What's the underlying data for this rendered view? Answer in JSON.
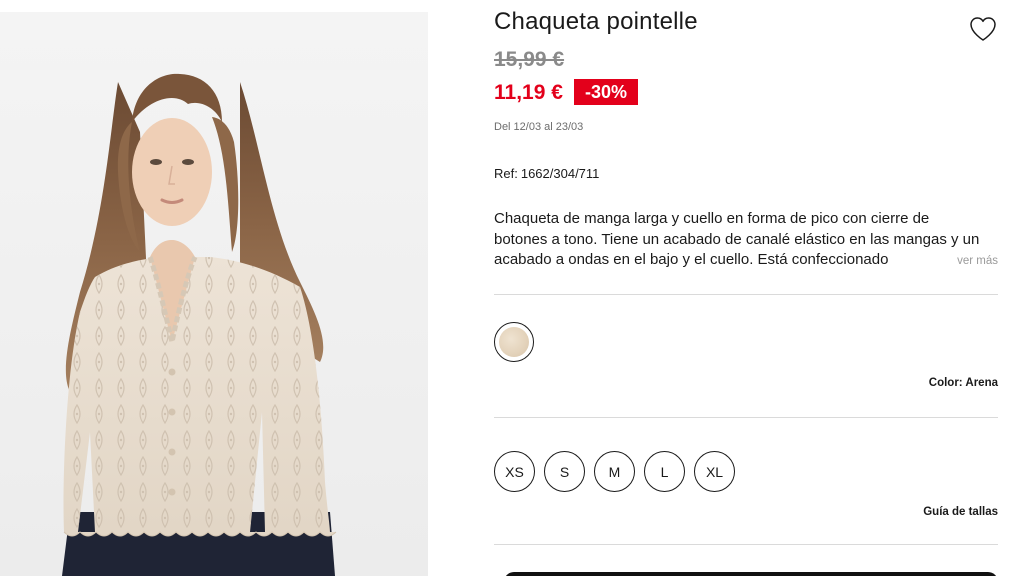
{
  "product": {
    "title": "Chaqueta pointelle",
    "old_price": "15,99 €",
    "new_price": "11,19 €",
    "discount": "-30%",
    "promo_dates": "Del 12/03 al 23/03",
    "ref_label": "Ref:",
    "ref_value": "1662/304/711",
    "description": "Chaqueta de manga larga y cuello en forma de pico con cierre de botones a tono. Tiene un acabado de canalé elástico en las mangas y un acabado a ondas en el bajo y el cuello. Está confeccionado",
    "see_more": "ver más"
  },
  "color": {
    "label": "Color: Arena",
    "swatch_color": "#e8d9c4"
  },
  "sizes": [
    "XS",
    "S",
    "M",
    "L",
    "XL"
  ],
  "size_guide": "Guía de tallas",
  "icons": {
    "wishlist": "heart-outline-icon"
  },
  "colors": {
    "sale_red": "#e3001b",
    "text": "#1a1a1a",
    "muted": "#8a8a8a",
    "divider": "#dadada"
  }
}
